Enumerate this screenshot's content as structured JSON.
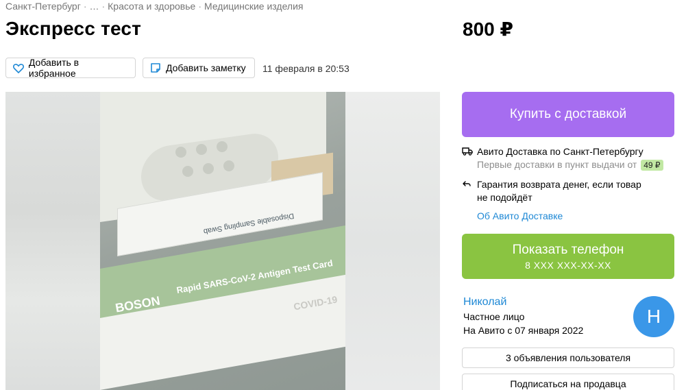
{
  "breadcrumb": [
    "Санкт-Петербург",
    "…",
    "Красота и здоровье",
    "Медицинские изделия"
  ],
  "listing": {
    "title": "Экспресс тест",
    "price": "800 ₽",
    "posted": "11 февраля в 20:53"
  },
  "actions": {
    "favorite_label": "Добавить в избранное",
    "note_label": "Добавить заметку"
  },
  "photo": {
    "product_label": "Rapid SARS-CoV-2 Antigen Test Card",
    "brand": "BOSON",
    "covid_mark": "COVID-19",
    "strip_label": "Disposable Sampling Swab"
  },
  "purchase": {
    "buy_label": "Купить с доставкой",
    "delivery_title": "Авито Доставка по Санкт-Петербургу",
    "delivery_note": "Первые доставки в пункт выдачи от",
    "delivery_price": "49 ₽",
    "guarantee_line1": "Гарантия возврата денег, если товар",
    "guarantee_line2": "не подойдёт",
    "about_link": "Об Авито Доставке"
  },
  "phone": {
    "label": "Показать телефон",
    "masked": "8 XXX XXX-XX-XX"
  },
  "seller": {
    "name": "Николай",
    "type": "Частное лицо",
    "since": "На Авито с 07 января 2022",
    "avatar_letter": "Н",
    "ads_label": "3 объявления пользователя",
    "subscribe_label": "Подписаться на продавца"
  },
  "colors": {
    "buy_button": "#a66df0",
    "phone_button": "#8ac441",
    "link": "#1e88d5",
    "avatar": "#3a97e8"
  },
  "icons": [
    "heart-icon",
    "note-icon",
    "truck-icon",
    "return-icon"
  ]
}
